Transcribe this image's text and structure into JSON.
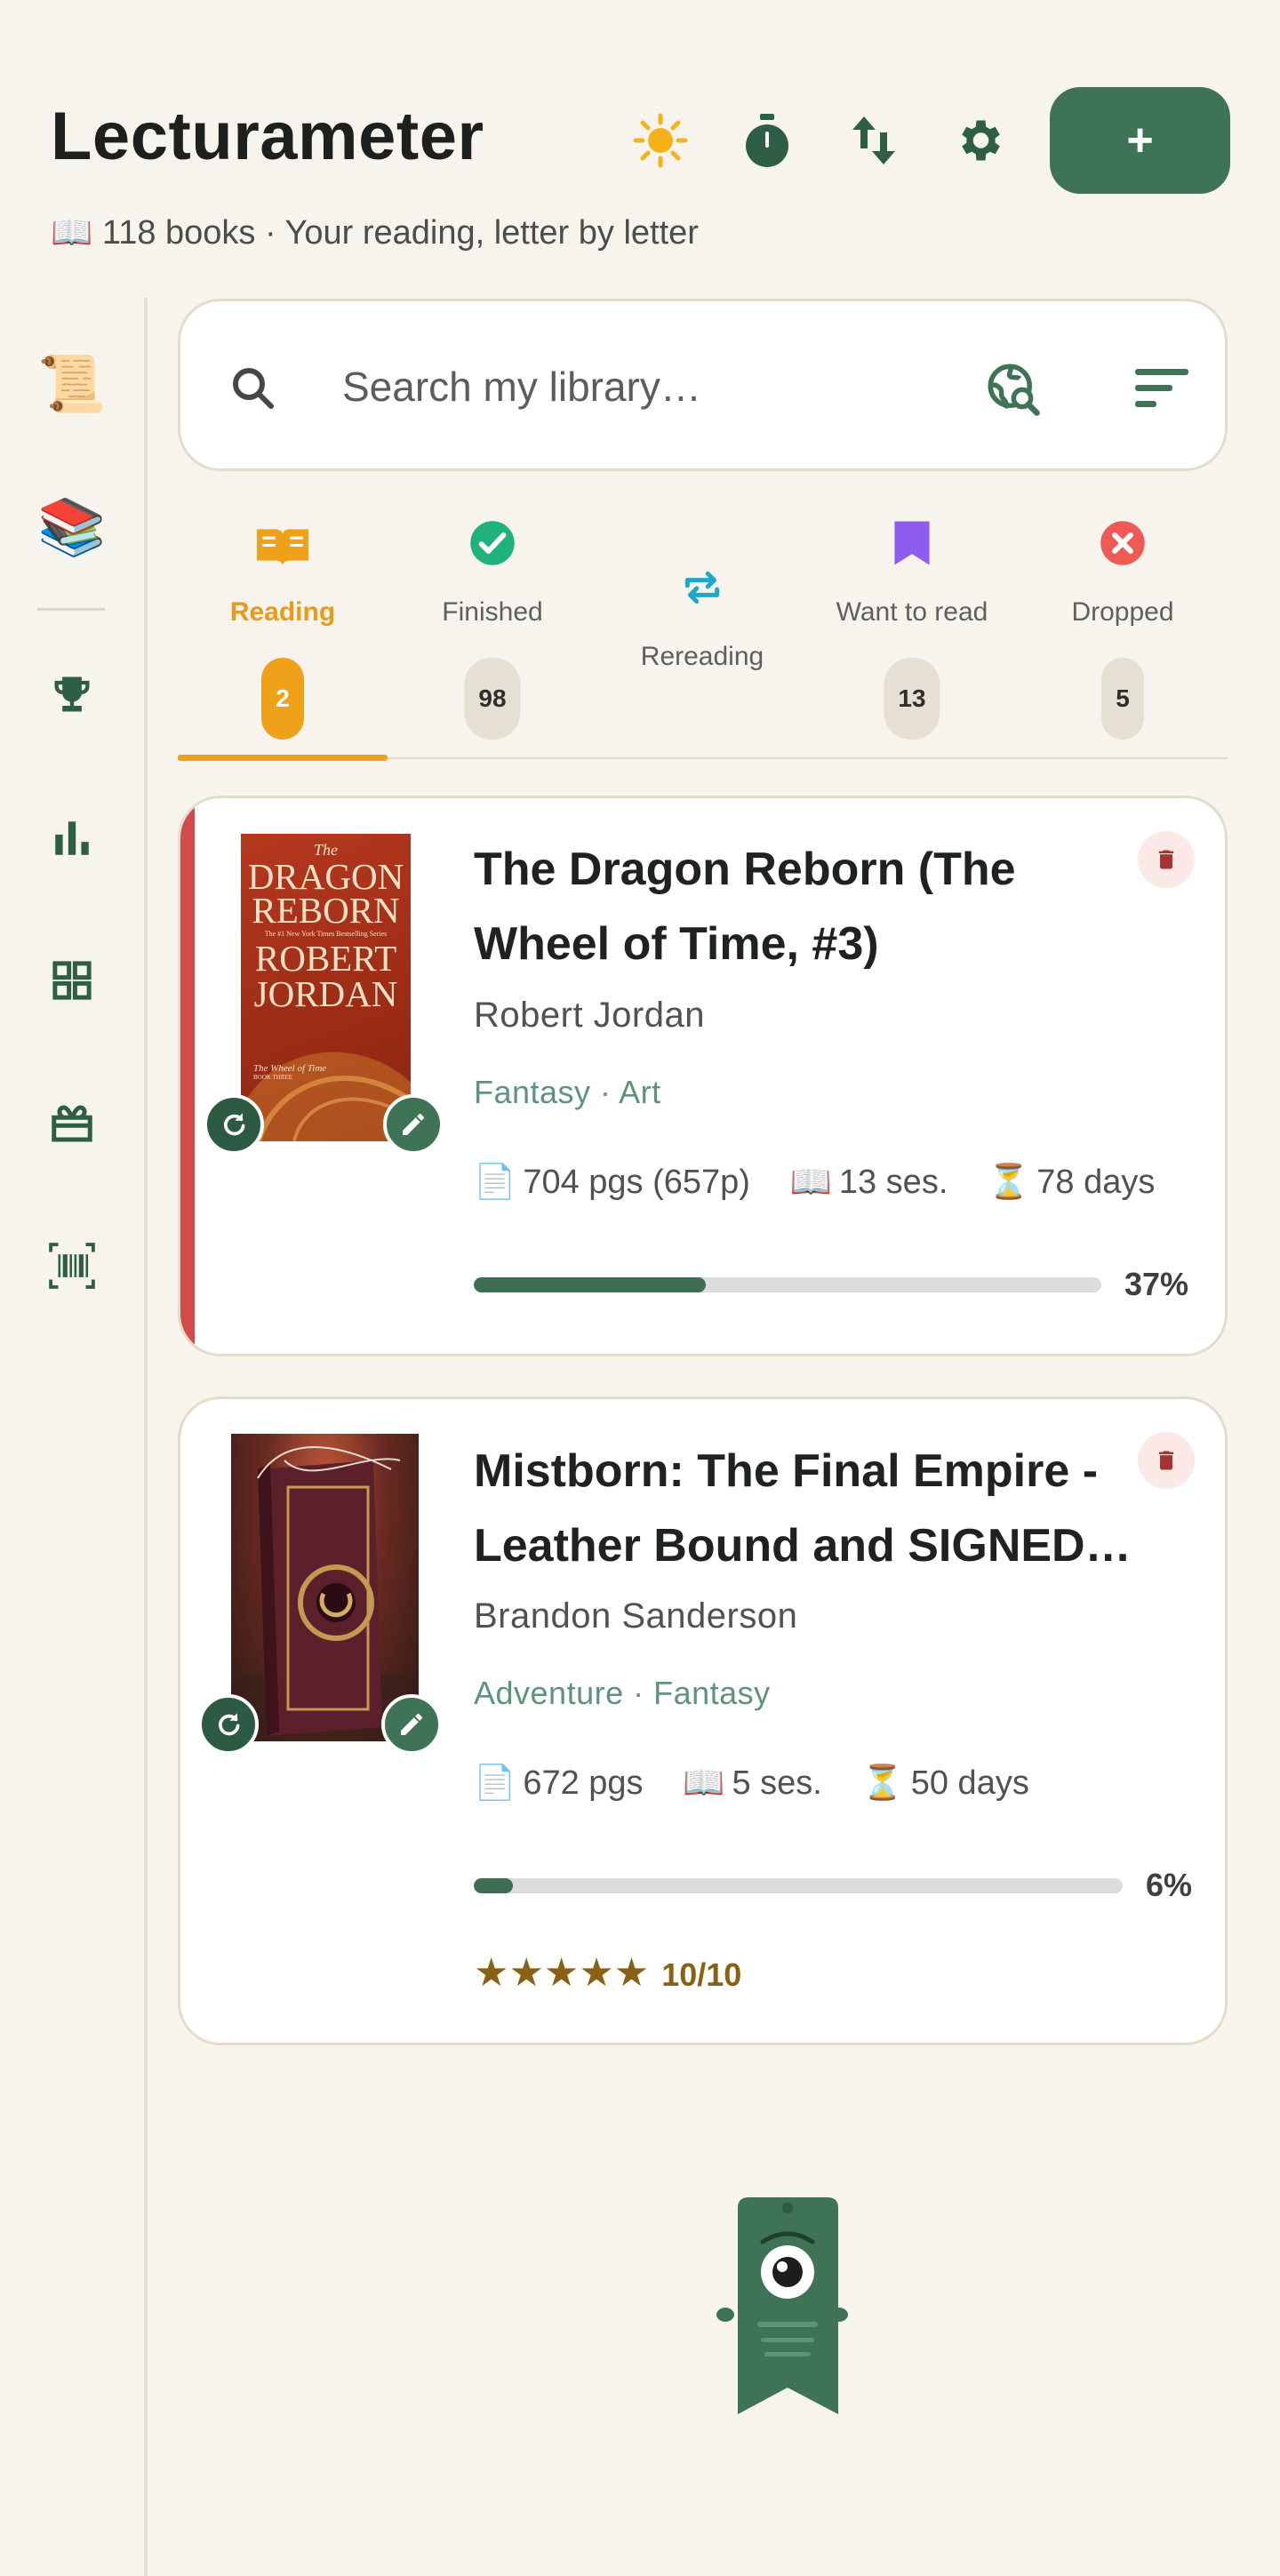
{
  "app": {
    "title": "Lecturameter",
    "subtitle_icon": "📖",
    "subtitle": "118 books · Your reading, letter by letter",
    "header_actions": [
      "sun-icon",
      "timer-icon",
      "import-export-icon",
      "gear-icon"
    ],
    "add_label": "+"
  },
  "sidebar": {
    "items": [
      {
        "icon": "scroll-icon",
        "glyph": "📜"
      },
      {
        "icon": "books-icon",
        "glyph": "📚"
      },
      {
        "icon": "trophy-icon"
      },
      {
        "icon": "bar-chart-icon"
      },
      {
        "icon": "grid-icon"
      },
      {
        "icon": "gift-icon"
      },
      {
        "icon": "barcode-scan-icon"
      }
    ]
  },
  "search": {
    "placeholder": "Search my library…",
    "value": ""
  },
  "tabs": [
    {
      "label": "Reading",
      "count": "2",
      "icon": "open-book-icon",
      "color": "#f0a11a",
      "active": true
    },
    {
      "label": "Finished",
      "count": "98",
      "icon": "check-circle-icon",
      "color": "#1fb27a"
    },
    {
      "label": "Rereading",
      "count": "",
      "icon": "repeat-icon",
      "color": "#1fa9c9"
    },
    {
      "label": "Want to read",
      "count": "13",
      "icon": "bookmark-icon",
      "color": "#8f5cf2"
    },
    {
      "label": "Dropped",
      "count": "5",
      "icon": "close-circle-icon",
      "color": "#ef5a55"
    }
  ],
  "books": [
    {
      "title_line1": "The Dragon Reborn (The",
      "title_line2": "Wheel of Time, #3)",
      "author": "Robert Jordan",
      "tags": "Fantasy · Art",
      "pages": "704 pgs (657p)",
      "sessions": "13 ses.",
      "days": "78 days",
      "progress": 0.37,
      "progress_label": "37%",
      "cover": {
        "top": "The",
        "title1": "DRAGON",
        "title2": "REBORN",
        "tagline": "The #1 New York Times Bestselling Series",
        "author1": "ROBERT",
        "author2": "JORDAN",
        "series": "The Wheel of Time",
        "book_no": "BOOK THREE"
      }
    },
    {
      "title_line1": "Mistborn: The Final Empire -",
      "title_line2": "Leather Bound and SIGNED…",
      "author": "Brandon Sanderson",
      "tags": "Adventure · Fantasy",
      "pages": "672 pgs",
      "sessions": "5 ses.",
      "days": "50 days",
      "progress": 0.06,
      "progress_label": "6%",
      "rating_stars": "★★★★★",
      "rating_value": "10/10"
    }
  ],
  "stat_icons": {
    "pages": "📄",
    "sessions": "📖",
    "days": "⏳"
  },
  "colors": {
    "accent_green": "#3f7356",
    "reading_orange": "#f0a11a",
    "background": "#f7f4ee",
    "card_accent_red": "#d24a4a"
  }
}
